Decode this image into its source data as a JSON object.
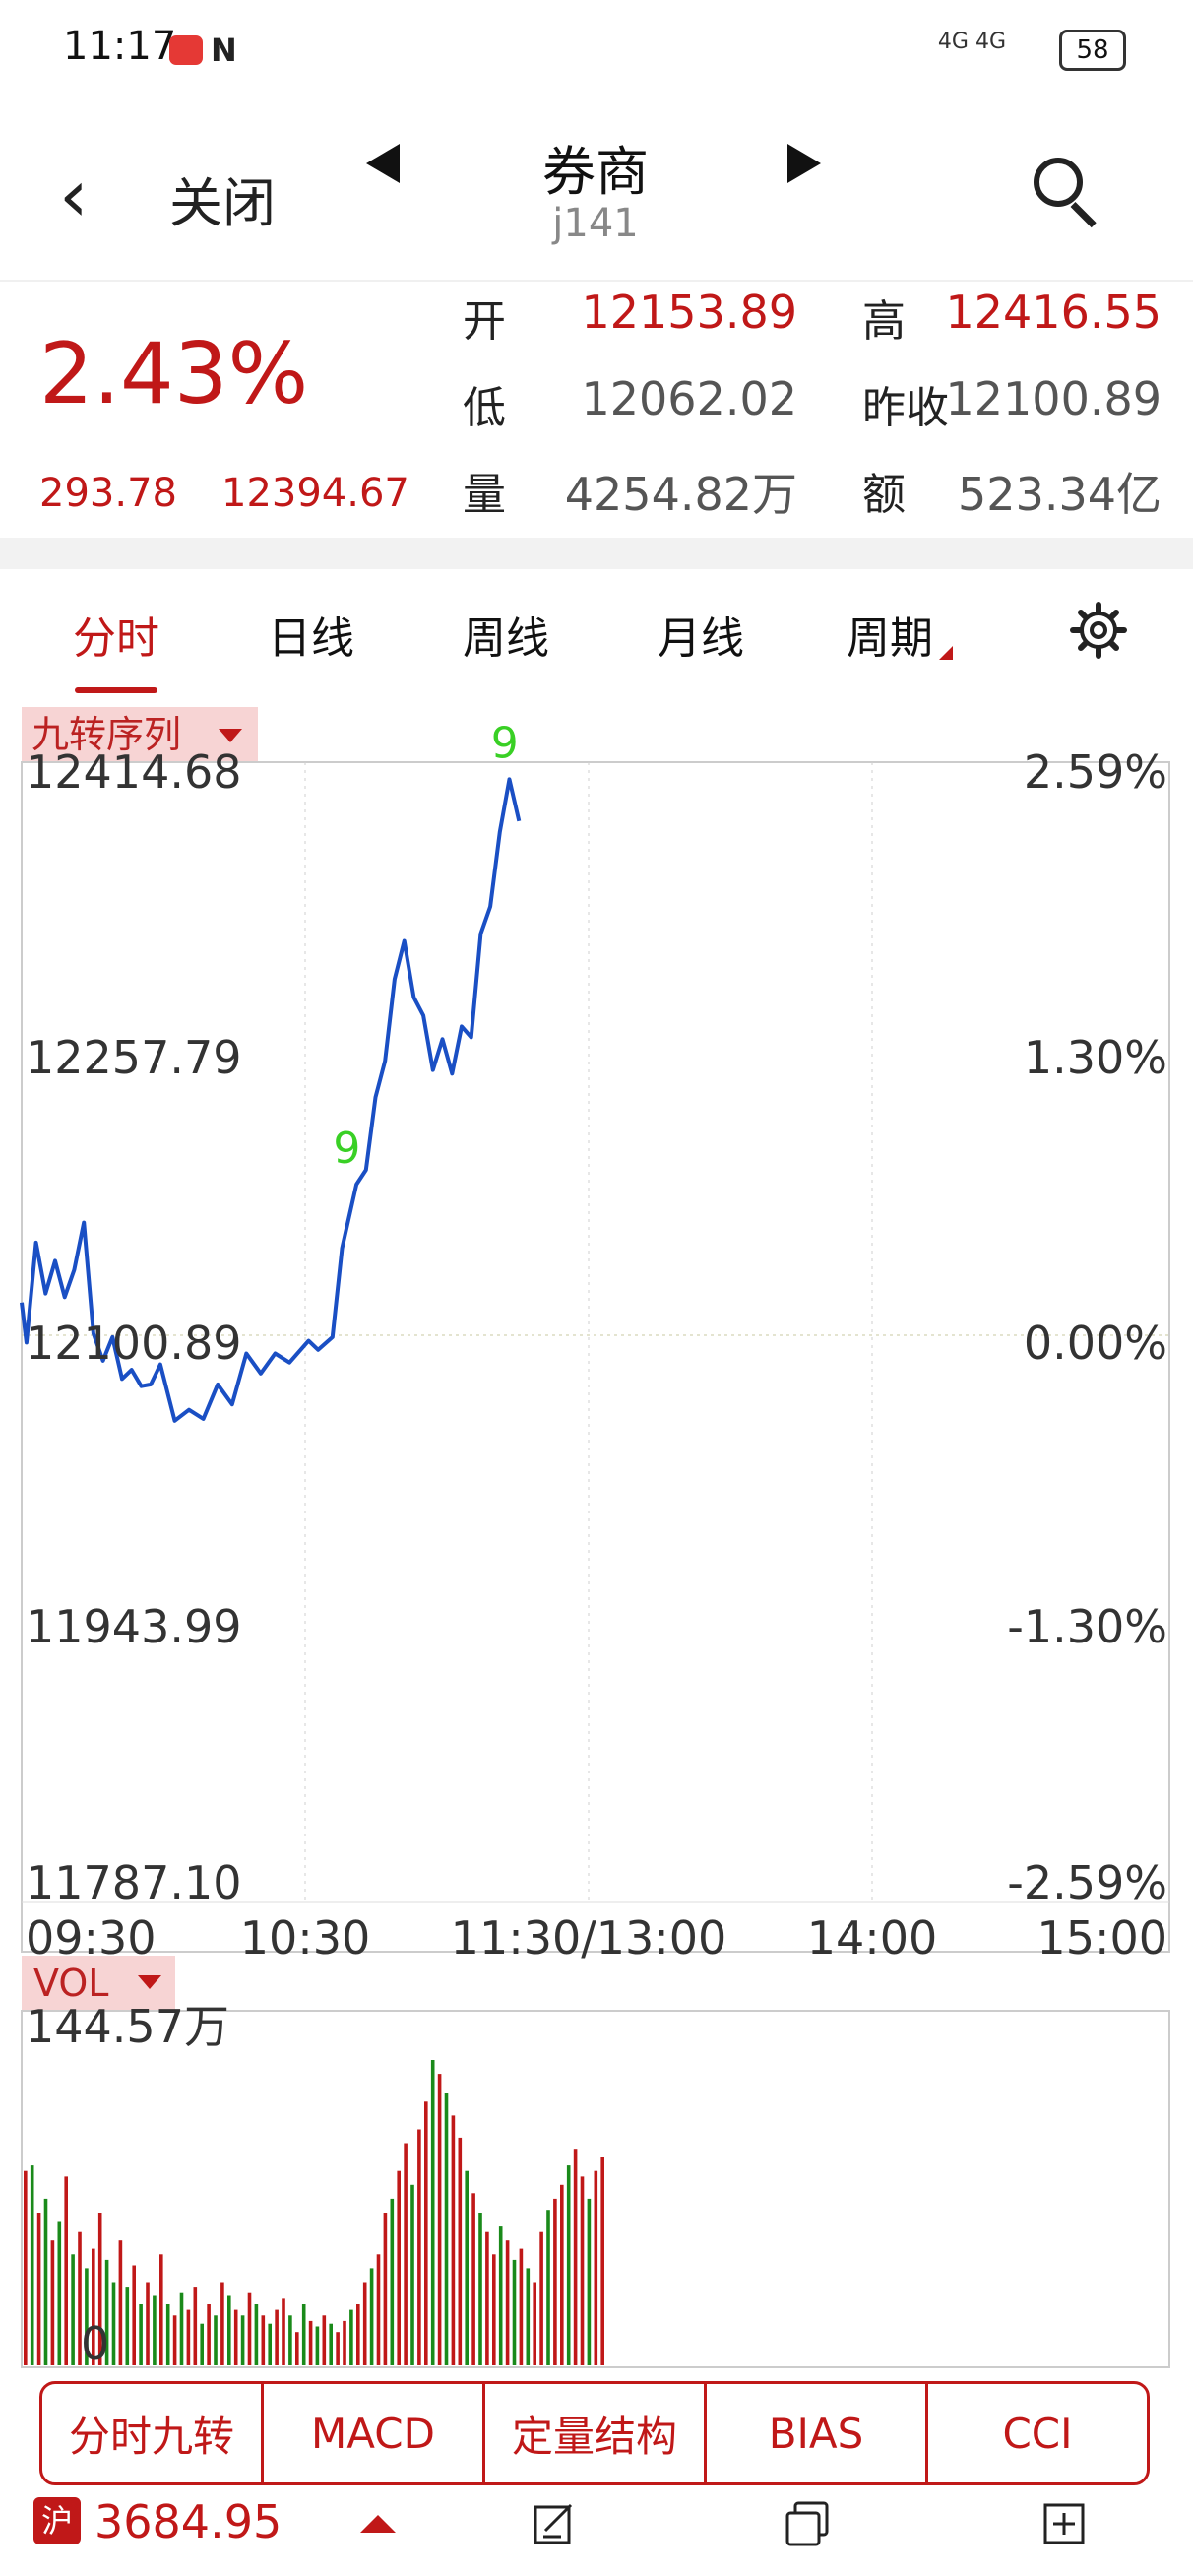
{
  "status_bar": {
    "time": "11:17",
    "nfc": "N",
    "signal": "4G 4G",
    "battery": "58"
  },
  "header": {
    "back_icon": "chevron-left-icon",
    "close_label": "关闭",
    "title": "券商",
    "code": "j141"
  },
  "quote": {
    "change_pct": "2.43%",
    "change": "293.78",
    "price": "12394.67",
    "open_label": "开",
    "open": "12153.89",
    "high_label": "高",
    "high": "12416.55",
    "low_label": "低",
    "low": "12062.02",
    "prev_close_label": "昨收",
    "prev_close": "12100.89",
    "volume_label": "量",
    "volume": "4254.82万",
    "amount_label": "额",
    "amount": "523.34亿"
  },
  "tabs": [
    "分时",
    "日线",
    "周线",
    "月线",
    "周期"
  ],
  "active_tab": "分时",
  "indicator_label": "九转序列",
  "vol_label": "VOL",
  "colors": {
    "red": "#c01818",
    "line": "#1a4fc4",
    "green": "#1a8a1a",
    "marker": "#c000c0",
    "nine": "#39d025"
  },
  "chart_data": {
    "type": "line",
    "x_ticks": [
      "09:30",
      "10:30",
      "11:30/13:00",
      "14:00",
      "15:00"
    ],
    "y_ticks_left": [
      "12414.68",
      "12257.79",
      "12100.89",
      "11943.99",
      "11787.10"
    ],
    "y_ticks_right": [
      "2.59%",
      "1.30%",
      "0.00%",
      "-1.30%",
      "-2.59%"
    ],
    "ylim": [
      11787.1,
      12414.68
    ],
    "prev_close": 12100.89,
    "minutes": [
      0,
      2,
      4,
      6,
      8,
      10,
      12,
      14,
      16,
      18,
      20,
      22,
      24,
      26,
      28,
      30,
      32,
      34,
      36,
      38,
      40,
      42,
      44,
      46,
      48,
      50,
      52,
      54,
      56,
      58,
      60,
      62,
      64,
      66,
      68,
      70,
      72,
      74,
      76,
      78,
      80,
      82,
      84,
      86,
      88,
      90,
      92,
      94,
      96,
      98,
      100,
      102,
      104,
      106,
      108,
      110,
      112,
      114,
      116,
      118,
      120
    ],
    "price_line": [
      12127,
      12105,
      12160,
      12132,
      12150,
      12130,
      12145,
      12171,
      12110,
      12095,
      12108,
      12085,
      12090,
      12081,
      12082,
      12093,
      12062,
      12068,
      12063,
      12082,
      12071,
      12099,
      12088,
      12099,
      12094,
      12106,
      12101,
      12108,
      12157,
      12192,
      12200,
      12240,
      12260,
      12305,
      12326,
      12295,
      12285,
      12255,
      12272,
      12253,
      12279,
      12273,
      12330,
      12345,
      12386,
      12415,
      12392
    ],
    "price_line_minutes": [
      0,
      1,
      3,
      5,
      7,
      9,
      11,
      13,
      15,
      17,
      19,
      21,
      23,
      25,
      27,
      29,
      32,
      35,
      38,
      41,
      44,
      47,
      50,
      53,
      56,
      60,
      62,
      65,
      67,
      70,
      72,
      74,
      76,
      78,
      80,
      82,
      84,
      86,
      88,
      90,
      92,
      94,
      96,
      98,
      100,
      102,
      104
    ],
    "nine_signals": [
      {
        "minute": 68,
        "label": "9"
      },
      {
        "minute": 101,
        "label": "9"
      }
    ],
    "volume_axis_top": "144.57万",
    "volume_axis_zero": "0",
    "volume": [
      70,
      72,
      55,
      60,
      45,
      52,
      68,
      40,
      48,
      35,
      42,
      55,
      38,
      30,
      45,
      28,
      36,
      22,
      30,
      25,
      40,
      22,
      18,
      26,
      20,
      28,
      15,
      22,
      18,
      30,
      25,
      20,
      18,
      26,
      22,
      18,
      15,
      20,
      24,
      18,
      12,
      22,
      16,
      14,
      18,
      15,
      12,
      16,
      20,
      22,
      30,
      35,
      40,
      55,
      60,
      70,
      80,
      65,
      85,
      95,
      110,
      105,
      98,
      90,
      82,
      70,
      62,
      55,
      48,
      40,
      50,
      45,
      38,
      42,
      35,
      30,
      48,
      56,
      60,
      65,
      72,
      78,
      68,
      60,
      70,
      75
    ],
    "volume_up": [
      1,
      0,
      1,
      0,
      1,
      0,
      1,
      0,
      1,
      0,
      1,
      1,
      0,
      0,
      1,
      0,
      1,
      0,
      1,
      0,
      1,
      0,
      1,
      0,
      1,
      1,
      0,
      1,
      0,
      1,
      0,
      1,
      0,
      1,
      0,
      1,
      0,
      1,
      1,
      0,
      1,
      0,
      1,
      0,
      1,
      0,
      1,
      1,
      0,
      1,
      1,
      0,
      1,
      1,
      0,
      1,
      1,
      0,
      1,
      1,
      0,
      1,
      0,
      1,
      1,
      0,
      1,
      0,
      1,
      1,
      0,
      1,
      0,
      1,
      0,
      1,
      1,
      0,
      1,
      1,
      0,
      1,
      1,
      0,
      1,
      1
    ]
  },
  "bottom_buttons": [
    "分时九转",
    "MACD",
    "定量结构",
    "BIAS",
    "CCI"
  ],
  "bottom_nav": {
    "market_badge": "沪",
    "index_value": "3684.95",
    "icons": [
      "edit-icon",
      "copy-icon",
      "add-icon"
    ]
  }
}
